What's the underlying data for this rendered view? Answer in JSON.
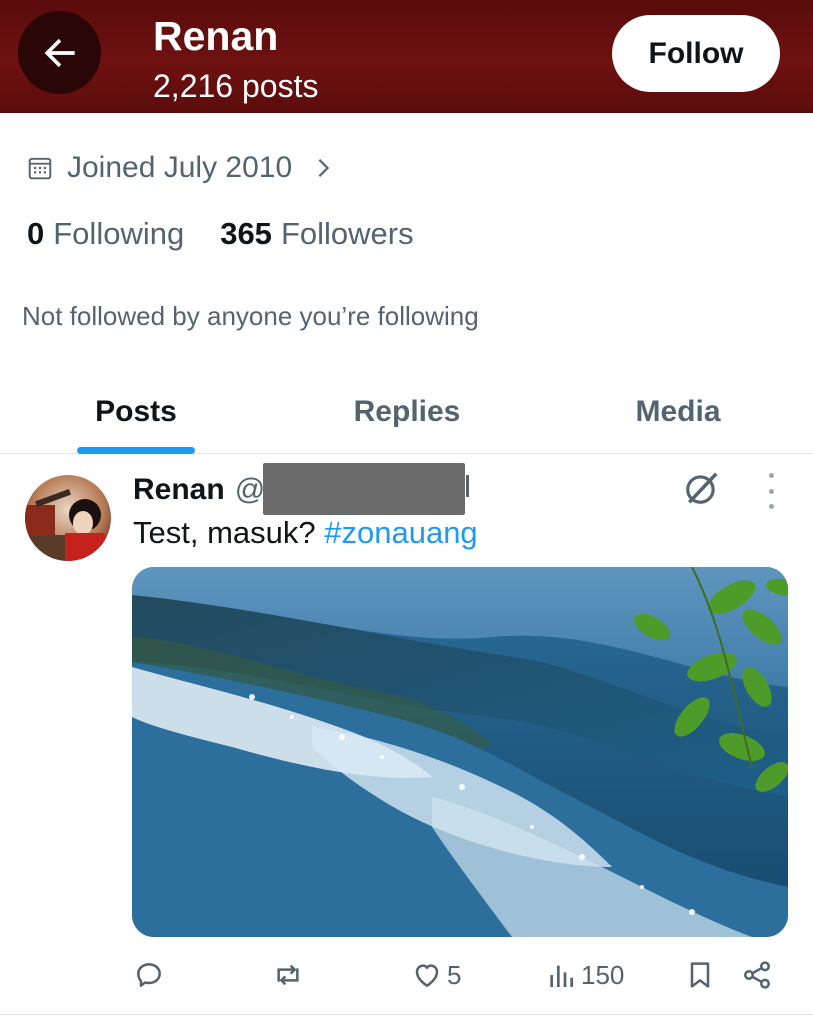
{
  "header": {
    "name": "Renan",
    "post_count": "2,216 posts",
    "follow_label": "Follow",
    "background_color": "#6e1111",
    "back_icon": "arrow-left-icon"
  },
  "profile": {
    "joined": "Joined July 2010",
    "following_count": "0",
    "following_label": "Following",
    "followers_count": "365",
    "followers_label": "Followers",
    "not_followed": "Not followed by anyone you’re following"
  },
  "tabs": [
    {
      "label": "Posts",
      "active": true
    },
    {
      "label": "Replies",
      "active": false
    },
    {
      "label": "Media",
      "active": false
    }
  ],
  "post": {
    "name": "Renan",
    "handle_prefix": "@",
    "text": "Test, masuk? ",
    "hashtag": "#zonauang",
    "actions": {
      "reply_icon": "reply-icon",
      "repost_icon": "repost-icon",
      "likes": "5",
      "views": "150",
      "bookmark_icon": "bookmark-icon",
      "share_icon": "share-icon"
    }
  },
  "colors": {
    "accent": "#1d9bf0",
    "text_secondary": "#536471"
  }
}
